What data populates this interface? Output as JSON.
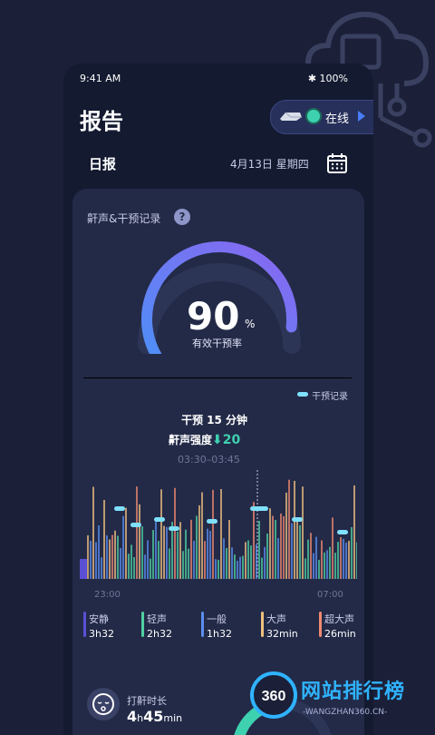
{
  "status_bar": {
    "time": "9:41 AM",
    "battery": "100%"
  },
  "header": {
    "title": "报告",
    "device_status": "在线"
  },
  "subheader": {
    "label": "日报",
    "date": "4月13日  星期四"
  },
  "card": {
    "title": "鼾声&干预记录",
    "help": "?",
    "gauge": {
      "value": "90",
      "unit": "%",
      "label": "有效干预率",
      "fraction": 0.9
    },
    "legend": "干预记录",
    "tooltip": {
      "line1": "干预 15 分钟",
      "line2_label": "鼾声强度",
      "line2_value": "20",
      "time_range": "03:30–03:45"
    },
    "axis": {
      "start": "23:00",
      "end": "07:00"
    },
    "stats": [
      {
        "label": "安静",
        "value": "3h32",
        "color": "#5b4fd6"
      },
      {
        "label": "轻声",
        "value": "2h32",
        "color": "#4fd0a0"
      },
      {
        "label": "一般",
        "value": "1h32",
        "color": "#5b8df0"
      },
      {
        "label": "大声",
        "value": "32min",
        "color": "#f0c080"
      },
      {
        "label": "超大声",
        "value": "26min",
        "color": "#f08a70"
      }
    ],
    "snore": {
      "label": "打鼾时长",
      "hours": "4",
      "h_unit": "h",
      "minutes": "45",
      "m_unit": "min"
    }
  },
  "watermark": {
    "text": "网站排行榜",
    "sub": "-WANGZHAN360.CN-",
    "badge": "360"
  }
}
